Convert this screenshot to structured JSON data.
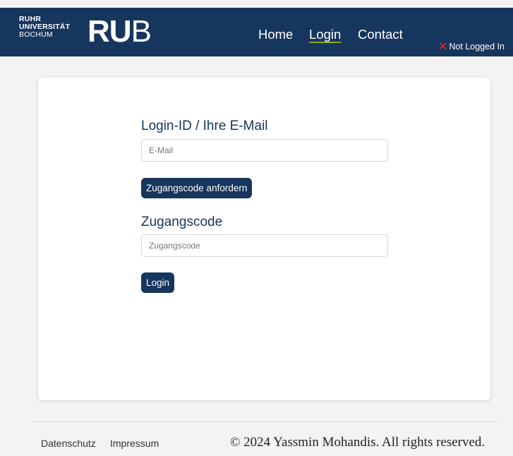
{
  "header": {
    "logo": {
      "line1": "RUHR",
      "line2": "UNIVERSITÄT",
      "line3": "BOCHUM",
      "mark_bold": "RU",
      "mark_light": "B"
    },
    "nav": [
      {
        "label": "Home"
      },
      {
        "label": "Login",
        "active": true
      },
      {
        "label": "Contact"
      }
    ],
    "status": {
      "icon": "x-icon",
      "text": "Not Logged In"
    }
  },
  "form": {
    "email_label": "Login-ID / Ihre E-Mail",
    "email_placeholder": "E-Mail",
    "email_value": "",
    "request_button": "Zugangscode anfordern",
    "code_label": "Zugangscode",
    "code_placeholder": "Zugangscode",
    "code_value": "",
    "login_button": "Login"
  },
  "footer": {
    "links": [
      {
        "label": "Datenschutz"
      },
      {
        "label": "Impressum"
      }
    ],
    "copyright": "© 2024 Yassmin Mohandis. All rights reserved."
  },
  "colors": {
    "brand": "#17365d",
    "accent_underline": "#8dae10",
    "status_icon": "#e8271a"
  }
}
